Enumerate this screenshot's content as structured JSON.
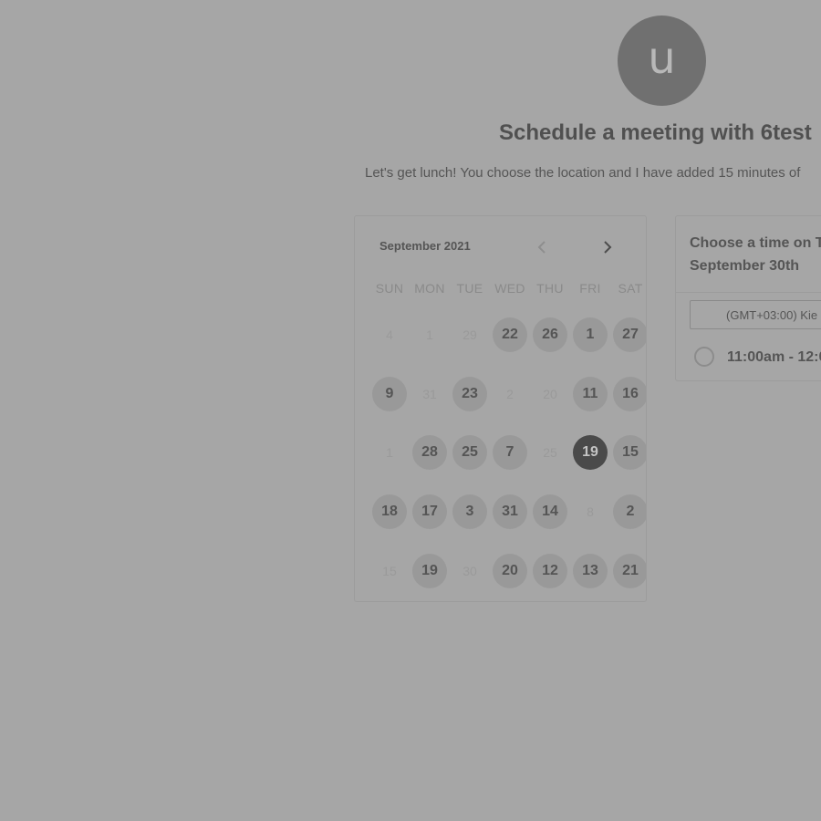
{
  "header": {
    "avatar_letter": "u",
    "title": "Schedule a meeting with 6test",
    "subtitle": "Let's get lunch! You choose the location and I have added 15 minutes of"
  },
  "calendar": {
    "month": "September 2021",
    "weekdays": [
      "SUN",
      "MON",
      "TUE",
      "WED",
      "THU",
      "FRI",
      "SAT"
    ],
    "weeks": [
      [
        {
          "label": "4",
          "state": "unavailable"
        },
        {
          "label": "1",
          "state": "unavailable"
        },
        {
          "label": "29",
          "state": "unavailable"
        },
        {
          "label": "22",
          "state": "available"
        },
        {
          "label": "26",
          "state": "available"
        },
        {
          "label": "1",
          "state": "available"
        },
        {
          "label": "27",
          "state": "available"
        }
      ],
      [
        {
          "label": "9",
          "state": "available"
        },
        {
          "label": "31",
          "state": "unavailable"
        },
        {
          "label": "23",
          "state": "available"
        },
        {
          "label": "2",
          "state": "unavailable"
        },
        {
          "label": "20",
          "state": "unavailable"
        },
        {
          "label": "11",
          "state": "available"
        },
        {
          "label": "16",
          "state": "available"
        }
      ],
      [
        {
          "label": "1",
          "state": "unavailable"
        },
        {
          "label": "28",
          "state": "available"
        },
        {
          "label": "25",
          "state": "available"
        },
        {
          "label": "7",
          "state": "available"
        },
        {
          "label": "25",
          "state": "unavailable"
        },
        {
          "label": "19",
          "state": "selected"
        },
        {
          "label": "15",
          "state": "available"
        }
      ],
      [
        {
          "label": "18",
          "state": "available"
        },
        {
          "label": "17",
          "state": "available"
        },
        {
          "label": "3",
          "state": "available"
        },
        {
          "label": "31",
          "state": "available"
        },
        {
          "label": "14",
          "state": "available"
        },
        {
          "label": "8",
          "state": "unavailable"
        },
        {
          "label": "2",
          "state": "available"
        }
      ],
      [
        {
          "label": "15",
          "state": "unavailable"
        },
        {
          "label": "19",
          "state": "available"
        },
        {
          "label": "30",
          "state": "unavailable"
        },
        {
          "label": "20",
          "state": "available"
        },
        {
          "label": "12",
          "state": "available"
        },
        {
          "label": "13",
          "state": "available"
        },
        {
          "label": "21",
          "state": "available"
        }
      ]
    ]
  },
  "time_panel": {
    "heading_line1": "Choose a time on T",
    "heading_line2": "September 30th",
    "timezone": "(GMT+03:00) Kie",
    "slots": [
      {
        "label": "11:00am - 12:0"
      }
    ]
  },
  "colors": {
    "background": "#a6a6a6",
    "avatar": "#707070",
    "day_available": "#999999",
    "day_selected": "#4a4a4a"
  }
}
